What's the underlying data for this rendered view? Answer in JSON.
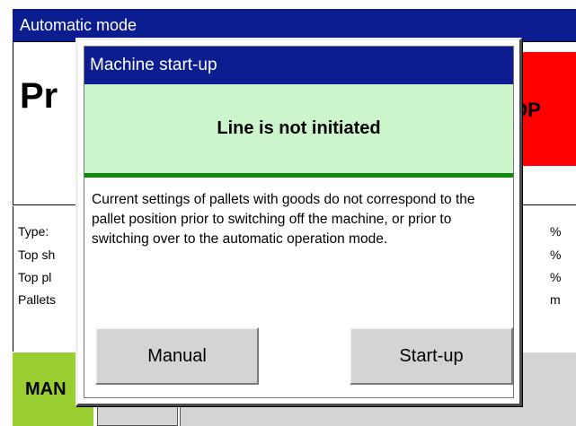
{
  "window": {
    "title": "Automatic mode",
    "main_heading_fragment": "Pr",
    "stop_fragment": "OP"
  },
  "info": {
    "labels": [
      "Type:",
      "Top sh",
      "Top pl",
      "Pallets"
    ],
    "units": [
      "%",
      "%",
      "%",
      "m"
    ]
  },
  "bottom_bar": {
    "manual_fragment": "MAN"
  },
  "dialog": {
    "title": "Machine start-up",
    "status": "Line is not initiated",
    "message": "Current settings of pallets with goods do not correspond to the pallet position prior to switching off the machine, or prior to switching over to the automatic operation mode.",
    "buttons": {
      "manual": "Manual",
      "startup": "Start-up"
    }
  },
  "colors": {
    "title_bar": "#0b1d8f",
    "status_background": "#ccf5cc",
    "status_divider": "#0f8a0f",
    "stop_button": "#ff0000",
    "manual_tab": "#9acd32",
    "button_gray": "#d4d4d4"
  }
}
